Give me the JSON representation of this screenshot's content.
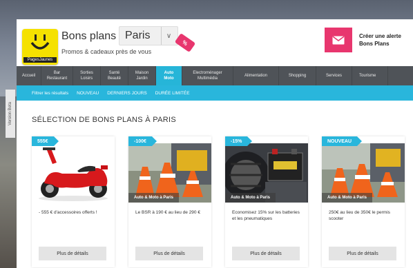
{
  "header": {
    "logo_text": "PagesJaunes",
    "title": "Bons plans à",
    "city": "Paris",
    "discount_tag": "%",
    "subtitle": "Promos & cadeaux près de vous",
    "alert": {
      "line1": "Créer une alerte",
      "line2": "Bons Plans"
    }
  },
  "side_tab": "Version Beta",
  "nav": {
    "items": [
      {
        "line1": "Accueil",
        "line2": ""
      },
      {
        "line1": "Bar",
        "line2": "Restaurant"
      },
      {
        "line1": "Sorties",
        "line2": "Loisirs"
      },
      {
        "line1": "Santé",
        "line2": "Beauté"
      },
      {
        "line1": "Maison",
        "line2": "Jardin"
      },
      {
        "line1": "Auto",
        "line2": "Moto"
      },
      {
        "line1": "Electroménager",
        "line2": "Multimédia"
      },
      {
        "line1": "Alimentation",
        "line2": ""
      },
      {
        "line1": "Shopping",
        "line2": ""
      },
      {
        "line1": "Services",
        "line2": ""
      },
      {
        "line1": "Tourisme",
        "line2": ""
      }
    ]
  },
  "filters": {
    "label": "Filtrer les résultats",
    "options": [
      "NOUVEAU",
      "DERNIERS JOURS",
      "DURÉE LIMITÉE"
    ]
  },
  "section_title": "SÉLECTION DE BONS PLANS À PARIS",
  "cards": [
    {
      "badge": "555€",
      "category": "",
      "description": "- 555 € d'accessoires offerts !",
      "button": "Plus de détails"
    },
    {
      "badge": "-100€",
      "category": "Auto & Moto à Paris",
      "description": "Le BSR à 190 € au lieu de 290 €",
      "button": "Plus de détails"
    },
    {
      "badge": "-15%",
      "category": "Auto & Moto à Paris",
      "description": "Economisez 15% sur les batteries et les pneumatiques",
      "button": "Plus de détails"
    },
    {
      "badge": "NOUVEAU",
      "category": "Auto & Moto à Paris",
      "description": "250€ au lieu de 350€ le permis scooter",
      "button": "Plus de détails"
    }
  ],
  "colors": {
    "accent_blue": "#29b6dc",
    "accent_pink": "#e8366e",
    "logo_yellow": "#f5e100",
    "nav_gray": "#4f5358"
  }
}
